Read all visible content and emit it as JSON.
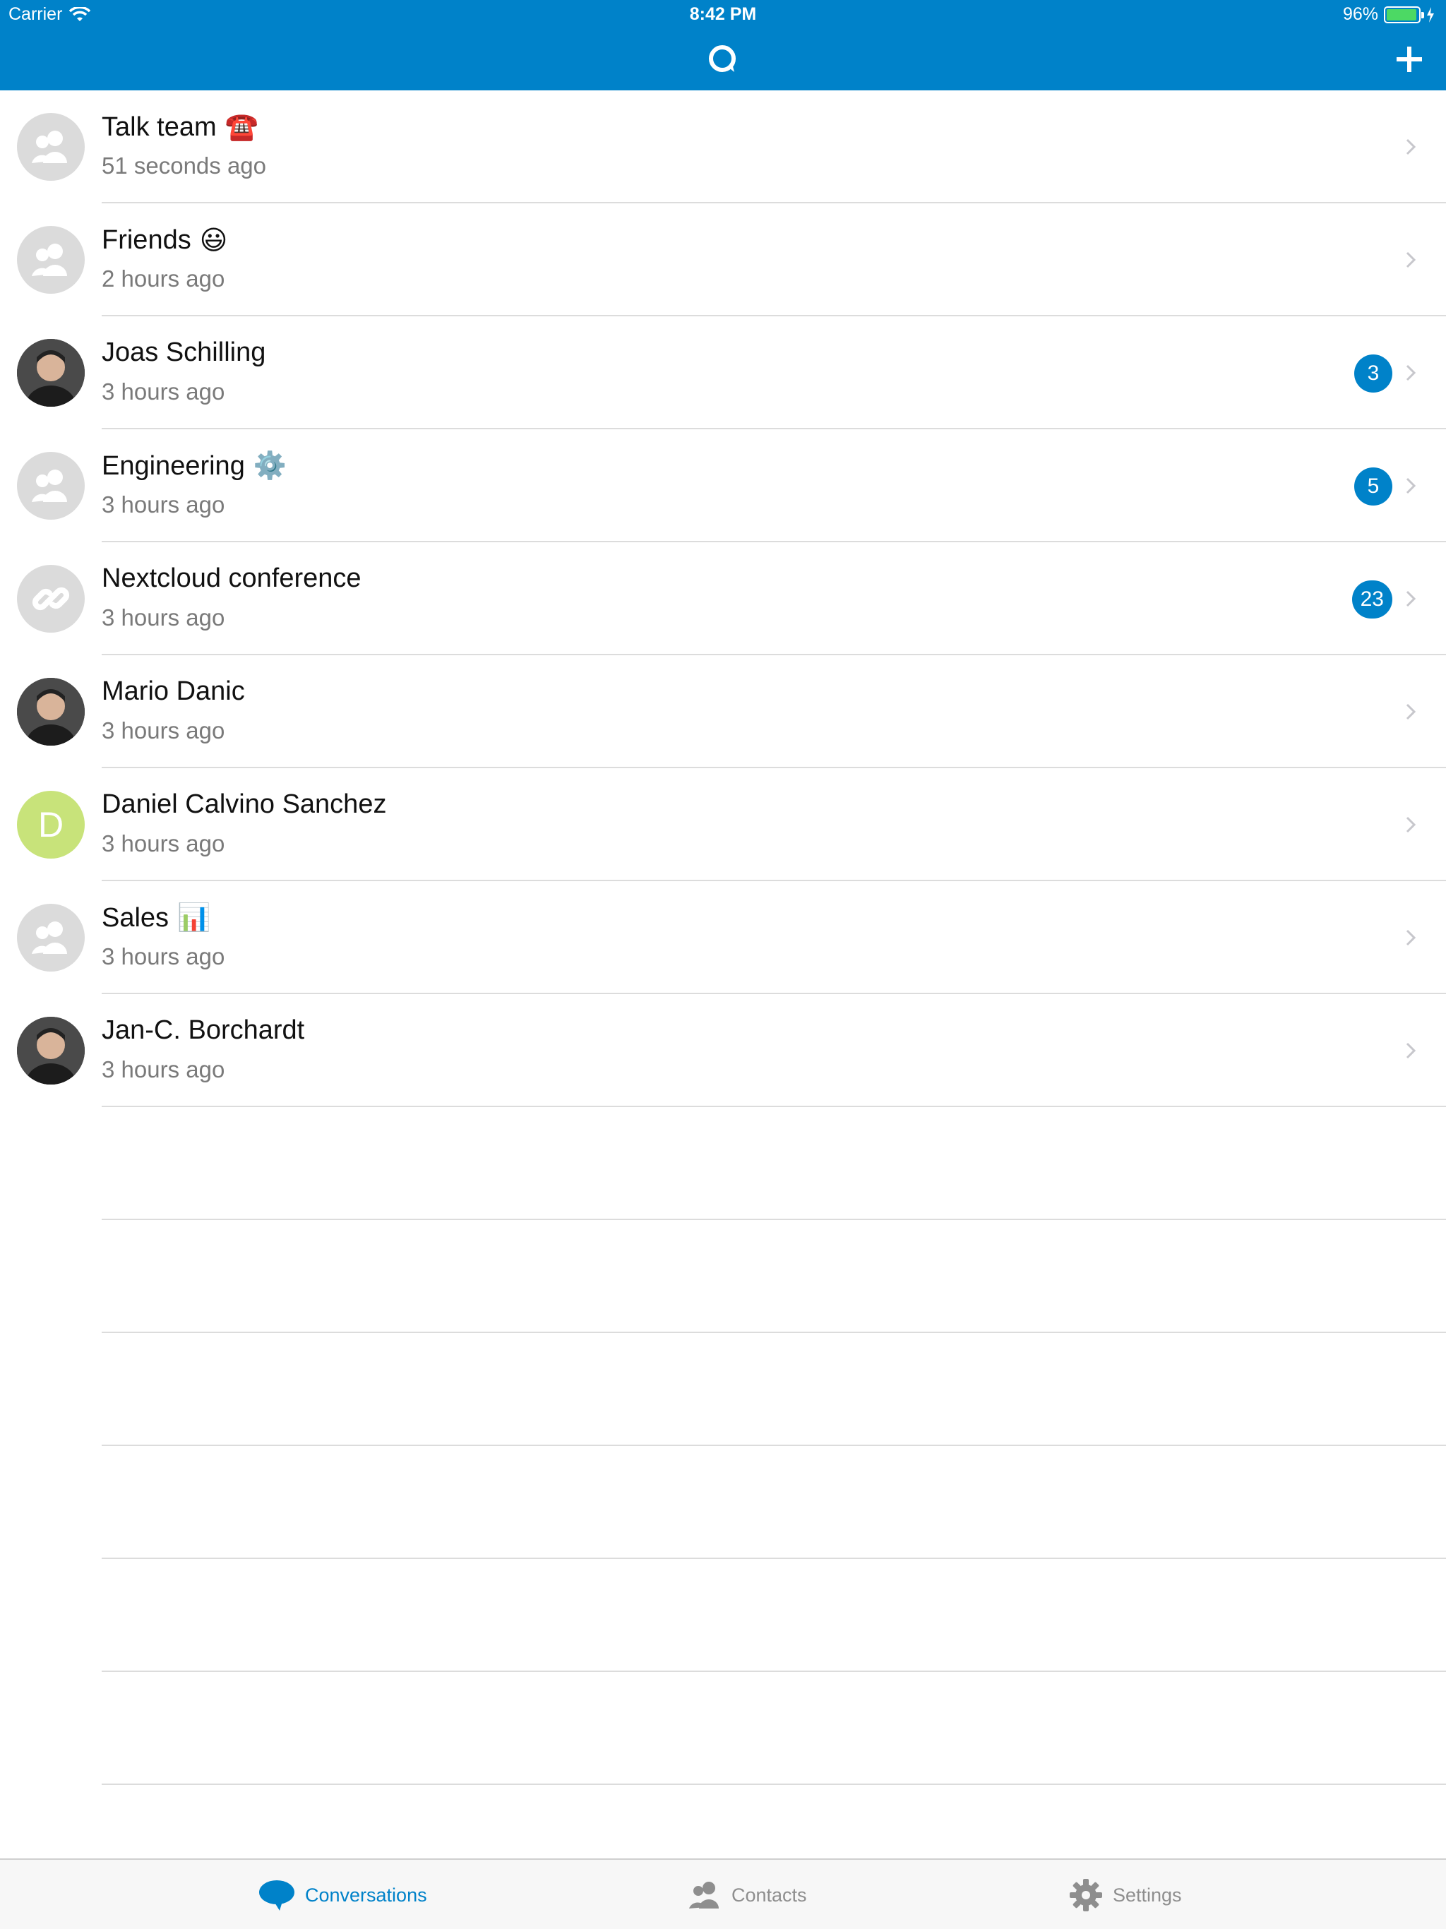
{
  "status_bar": {
    "carrier": "Carrier",
    "time": "8:42 PM",
    "battery": "96%",
    "battery_level": 0.96
  },
  "nav": {
    "logo_icon": "talk-logo-icon",
    "add_icon": "plus-icon"
  },
  "conversations": [
    {
      "name": "Talk team",
      "emoji": "☎️",
      "time": "51 seconds ago",
      "avatar": "group-icon",
      "badge": ""
    },
    {
      "name": "Friends",
      "emoji": "😃",
      "time": "2 hours ago",
      "avatar": "group-icon",
      "badge": ""
    },
    {
      "name": "Joas Schilling",
      "emoji": "",
      "time": "3 hours ago",
      "avatar": "photo",
      "badge": "3"
    },
    {
      "name": "Engineering",
      "emoji": "⚙️",
      "time": "3 hours ago",
      "avatar": "group-icon",
      "badge": "5"
    },
    {
      "name": "Nextcloud conference",
      "emoji": "",
      "time": "3 hours ago",
      "avatar": "link-icon",
      "badge": "23"
    },
    {
      "name": "Mario Danic",
      "emoji": "",
      "time": "3 hours ago",
      "avatar": "photo",
      "badge": ""
    },
    {
      "name": "Daniel Calvino Sanchez",
      "emoji": "",
      "time": "3 hours ago",
      "avatar": "letter",
      "avatar_letter": "D",
      "badge": ""
    },
    {
      "name": "Sales",
      "emoji": "📊",
      "time": "3 hours ago",
      "avatar": "group-icon",
      "badge": ""
    },
    {
      "name": "Jan-C. Borchardt",
      "emoji": "",
      "time": "3 hours ago",
      "avatar": "photo",
      "badge": ""
    }
  ],
  "tabs": [
    {
      "label": "Conversations",
      "icon": "chat-bubble-icon",
      "active": true
    },
    {
      "label": "Contacts",
      "icon": "contacts-icon",
      "active": false
    },
    {
      "label": "Settings",
      "icon": "gear-icon",
      "active": false
    }
  ],
  "colors": {
    "primary": "#0082c9",
    "letter_avatar": "#c8e37a",
    "placeholder_avatar": "#dbdbdb"
  }
}
